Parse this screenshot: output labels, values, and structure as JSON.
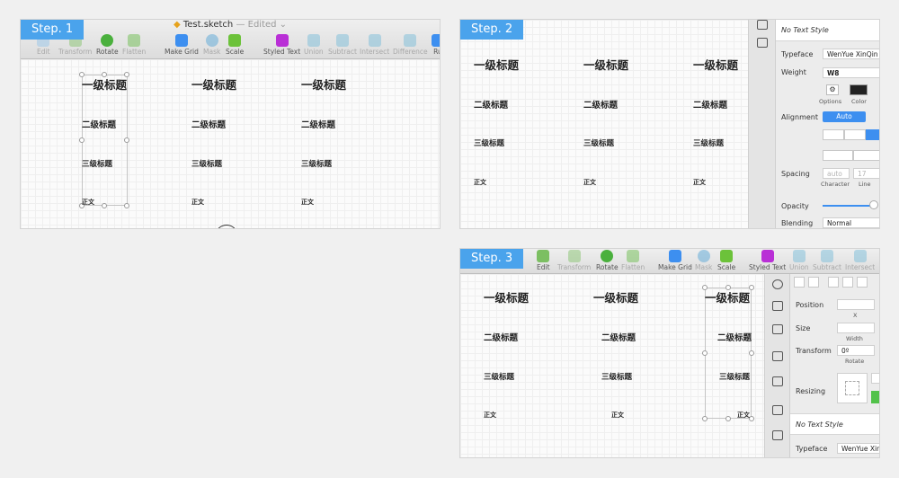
{
  "steps": {
    "step1": "Step. 1",
    "step2": "Step. 2",
    "step3": "Step. 3"
  },
  "toolbar": {
    "file_name": "Test.sketch",
    "edited_label": "— Edited ⌄",
    "tools": {
      "edit": "Edit",
      "transform": "Transform",
      "rotate": "Rotate",
      "flatten": "Flatten",
      "make_grid": "Make Grid",
      "mask": "Mask",
      "scale": "Scale",
      "styled_text": "Styled Text",
      "union": "Union",
      "subtract": "Subtract",
      "intersect": "Intersect",
      "difference": "Difference",
      "ru_cut": "Ru"
    }
  },
  "headings": {
    "h1": "一级标题",
    "h2": "二级标题",
    "h3": "三级标题",
    "body": "正文"
  },
  "inspector2": {
    "text_style": "No Text Style",
    "typeface_label": "Typeface",
    "typeface_value": "WenYue XinQin",
    "weight_label": "Weight",
    "weight_value": "W8",
    "options_label": "Options",
    "color_label": "Color",
    "alignment_label": "Alignment",
    "alignment_value": "Auto",
    "spacing_label": "Spacing",
    "spacing_placeholder": "auto",
    "line_placeholder": "17",
    "character_label": "Character",
    "line_label": "Line",
    "opacity_label": "Opacity",
    "blending_label": "Blending",
    "blending_value": "Normal"
  },
  "inspector3": {
    "position_label": "Position",
    "x_label": "X",
    "size_label": "Size",
    "width_label": "Width",
    "transform_label": "Transform",
    "rotate_value": "0º",
    "rotate_label": "Rotate",
    "resizing_label": "Resizing",
    "text_style": "No Text Style",
    "typeface_label": "Typeface",
    "typeface_value": "WenYue XinQin"
  },
  "colors": {
    "accent": "#4aa3ec",
    "blue_button": "#3d8ff0",
    "styled_text": "#b92fd6",
    "rotate_green": "#4ab03d"
  }
}
